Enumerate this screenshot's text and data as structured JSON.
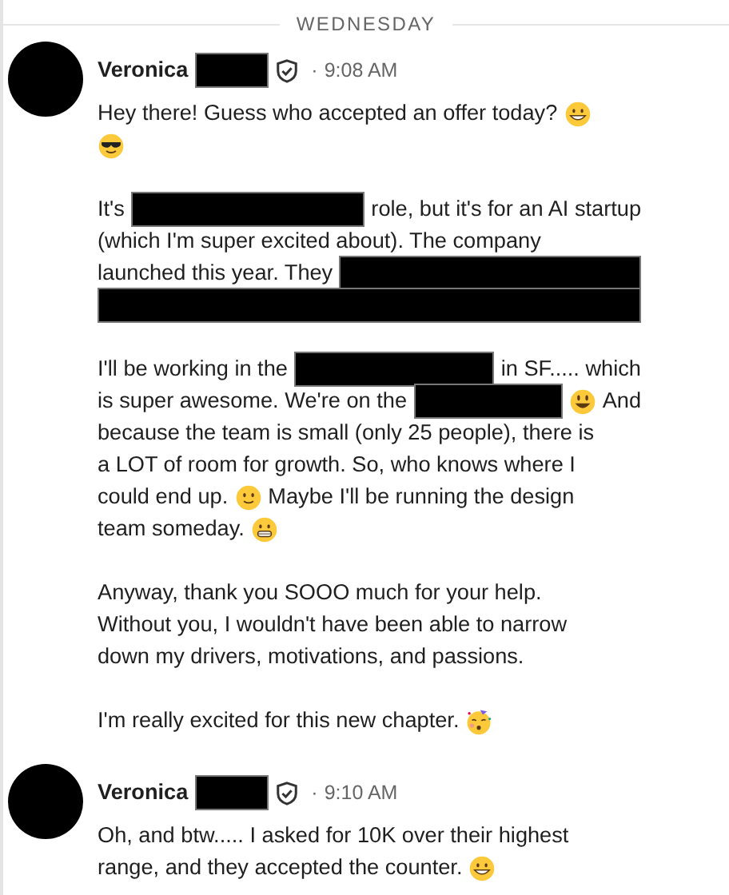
{
  "day_divider": "WEDNESDAY",
  "messages": [
    {
      "sender": [
        {
          "kind": "text",
          "text": "Veronica"
        },
        {
          "kind": "redacted"
        }
      ],
      "verified": true,
      "separator": "·",
      "time": "9:08 AM",
      "paragraphs": [
        [
          [
            {
              "kind": "text",
              "text": "Hey there! Guess who accepted an offer today?"
            },
            {
              "kind": "grin"
            }
          ],
          [
            {
              "kind": "cool"
            }
          ]
        ],
        [
          [
            {
              "kind": "text",
              "text": "It's"
            },
            {
              "kind": "redacted"
            },
            {
              "kind": "text",
              "text": "role, but it's for an AI startup"
            }
          ],
          [
            {
              "kind": "text",
              "text": "(which I'm super excited about). The company"
            }
          ],
          [
            {
              "kind": "text",
              "text": "launched this year. They"
            },
            {
              "kind": "redacted"
            }
          ],
          [
            {
              "kind": "redacted"
            }
          ]
        ],
        [
          [
            {
              "kind": "text",
              "text": "I'll be working in the"
            },
            {
              "kind": "redacted"
            },
            {
              "kind": "text",
              "text": "in SF..... which"
            }
          ],
          [
            {
              "kind": "text",
              "text": "is super awesome. We're on the"
            },
            {
              "kind": "redacted"
            },
            {
              "kind": "smiley"
            },
            {
              "kind": "text",
              "text": "And"
            }
          ],
          [
            {
              "kind": "text",
              "text": "because the team is small (only 25 people), there is"
            }
          ],
          [
            {
              "kind": "text",
              "text": "a LOT of room for growth. So, who knows where I"
            }
          ],
          [
            {
              "kind": "text",
              "text": "could end up."
            },
            {
              "kind": "smile"
            },
            {
              "kind": "text",
              "text": "Maybe I'll be running the design"
            }
          ],
          [
            {
              "kind": "text",
              "text": "team someday."
            },
            {
              "kind": "grimace"
            }
          ]
        ],
        [
          [
            {
              "kind": "text",
              "text": "Anyway, thank you SOOO much for your help."
            }
          ],
          [
            {
              "kind": "text",
              "text": "Without you, I wouldn't have been able to narrow"
            }
          ],
          [
            {
              "kind": "text",
              "text": "down my drivers, motivations, and passions."
            }
          ]
        ],
        [
          [
            {
              "kind": "text",
              "text": "I'm really excited for this new chapter."
            },
            {
              "kind": "party"
            }
          ]
        ]
      ]
    },
    {
      "sender": [
        {
          "kind": "text",
          "text": "Veronica"
        },
        {
          "kind": "redacted"
        }
      ],
      "verified": true,
      "separator": "·",
      "time": "9:10 AM",
      "paragraphs": [
        [
          [
            {
              "kind": "text",
              "text": "Oh, and btw..... I asked for 10K over their highest"
            }
          ],
          [
            {
              "kind": "text",
              "text": "range, and they accepted the counter."
            },
            {
              "kind": "grin"
            }
          ]
        ]
      ]
    }
  ]
}
